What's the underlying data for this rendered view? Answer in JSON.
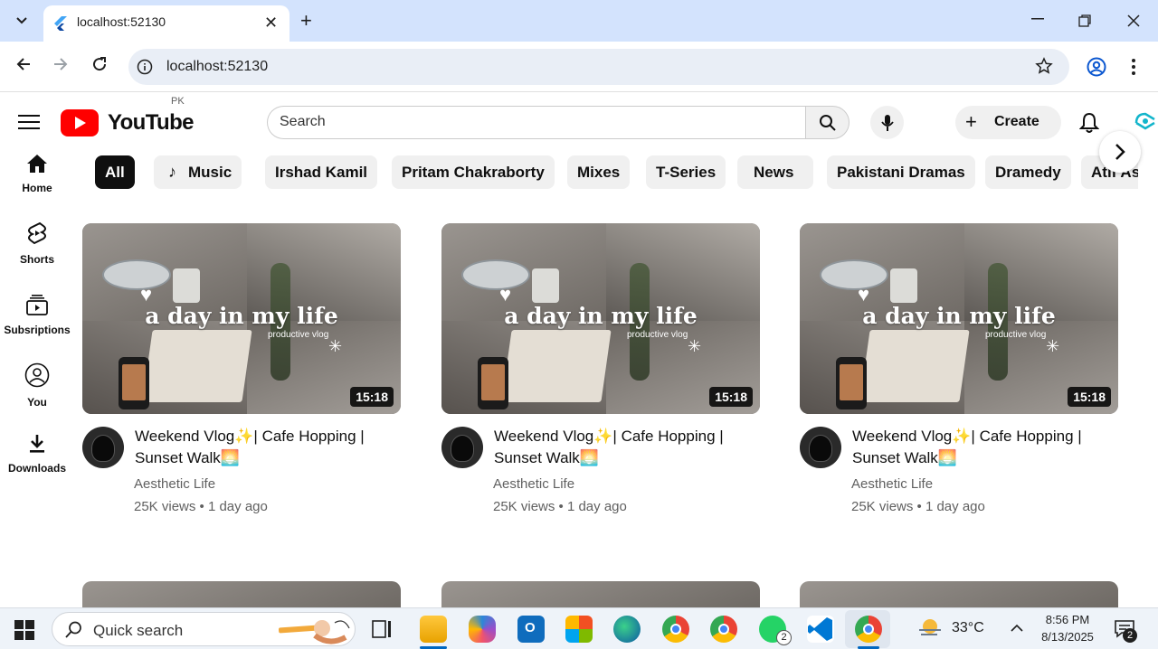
{
  "browser": {
    "tab_title": "localhost:52130",
    "url": "localhost:52130"
  },
  "youtube": {
    "logo_text": "YouTube",
    "country_code": "PK",
    "search_placeholder": "Search",
    "create_label": "Create",
    "chips": [
      "All",
      "Music",
      "Irshad Kamil",
      "Pritam Chakraborty",
      "Mixes",
      "T-Series",
      "News",
      "Pakistani Dramas",
      "Dramedy",
      "Atif As"
    ],
    "active_chip": "All",
    "sidebar": [
      {
        "label": "Home",
        "icon": "home-icon"
      },
      {
        "label": "Shorts",
        "icon": "shorts-icon"
      },
      {
        "label": "Subsriptions",
        "icon": "subscriptions-icon"
      },
      {
        "label": "You",
        "icon": "you-icon"
      },
      {
        "label": "Downloads",
        "icon": "download-icon"
      }
    ],
    "videos": [
      {
        "thumb_title": "a day in my life",
        "thumb_sub": "productive vlog",
        "duration": "15:18",
        "title": "Weekend Vlog✨| Cafe Hopping | Sunset Walk🌅",
        "channel": "Aesthetic Life",
        "meta": "25K views • 1 day ago"
      },
      {
        "thumb_title": "a day in my life",
        "thumb_sub": "productive vlog",
        "duration": "15:18",
        "title": "Weekend Vlog✨| Cafe Hopping | Sunset Walk🌅",
        "channel": "Aesthetic Life",
        "meta": "25K views • 1 day ago"
      },
      {
        "thumb_title": "a day in my life",
        "thumb_sub": "productive vlog",
        "duration": "15:18",
        "title": "Weekend Vlog✨| Cafe Hopping | Sunset Walk🌅",
        "channel": "Aesthetic Life",
        "meta": "25K views • 1 day ago"
      }
    ]
  },
  "taskbar": {
    "search_placeholder": "Quick search",
    "weather": "33°C",
    "time": "8:56 PM",
    "date": "8/13/2025",
    "whatsapp_badge": "2",
    "notification_badge": "2"
  },
  "colors": {
    "youtube_red": "#ff0000",
    "tabbar_bg": "#d3e3fd"
  }
}
